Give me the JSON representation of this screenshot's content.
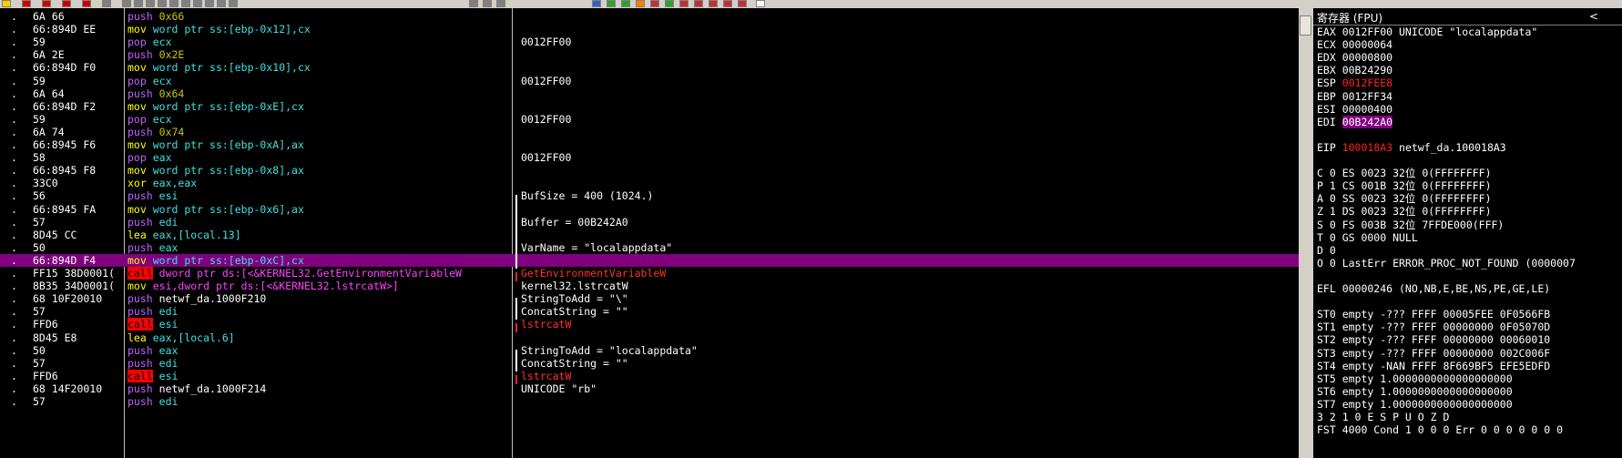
{
  "toolbar": {
    "buttons": 42
  },
  "cpu": {
    "rows": [
      {
        "dot": ".",
        "bytes": "6A 66",
        "mn": "push",
        "mcls": "kw-push",
        "ops": [
          {
            "t": "0x66",
            "c": "op-imm"
          }
        ],
        "comment": ""
      },
      {
        "dot": ".",
        "bytes": "66:894D EE",
        "mn": "mov",
        "mcls": "kw-mov",
        "ops": [
          {
            "t": "word ptr ss:[ebp-0x12],cx",
            "c": "op-mem"
          }
        ],
        "comment": ""
      },
      {
        "dot": ".",
        "bytes": "59",
        "mn": "pop",
        "mcls": "kw-pop",
        "ops": [
          {
            "t": "ecx",
            "c": "op-reg"
          }
        ],
        "comment": "0012FF00"
      },
      {
        "dot": ".",
        "bytes": "6A 2E",
        "mn": "push",
        "mcls": "kw-push",
        "ops": [
          {
            "t": "0x2E",
            "c": "op-imm"
          }
        ],
        "comment": ""
      },
      {
        "dot": ".",
        "bytes": "66:894D F0",
        "mn": "mov",
        "mcls": "kw-mov",
        "ops": [
          {
            "t": "word ptr ss:[ebp-0x10],cx",
            "c": "op-mem"
          }
        ],
        "comment": ""
      },
      {
        "dot": ".",
        "bytes": "59",
        "mn": "pop",
        "mcls": "kw-pop",
        "ops": [
          {
            "t": "ecx",
            "c": "op-reg"
          }
        ],
        "comment": "0012FF00"
      },
      {
        "dot": ".",
        "bytes": "6A 64",
        "mn": "push",
        "mcls": "kw-push",
        "ops": [
          {
            "t": "0x64",
            "c": "op-imm"
          }
        ],
        "comment": ""
      },
      {
        "dot": ".",
        "bytes": "66:894D F2",
        "mn": "mov",
        "mcls": "kw-mov",
        "ops": [
          {
            "t": "word ptr ss:[ebp-0xE],cx",
            "c": "op-mem"
          }
        ],
        "comment": ""
      },
      {
        "dot": ".",
        "bytes": "59",
        "mn": "pop",
        "mcls": "kw-pop",
        "ops": [
          {
            "t": "ecx",
            "c": "op-reg"
          }
        ],
        "comment": "0012FF00"
      },
      {
        "dot": ".",
        "bytes": "6A 74",
        "mn": "push",
        "mcls": "kw-push",
        "ops": [
          {
            "t": "0x74",
            "c": "op-imm"
          }
        ],
        "comment": ""
      },
      {
        "dot": ".",
        "bytes": "66:8945 F6",
        "mn": "mov",
        "mcls": "kw-mov",
        "ops": [
          {
            "t": "word ptr ss:[ebp-0xA],ax",
            "c": "op-mem"
          }
        ],
        "comment": ""
      },
      {
        "dot": ".",
        "bytes": "58",
        "mn": "pop",
        "mcls": "kw-pop",
        "ops": [
          {
            "t": "eax",
            "c": "op-reg"
          }
        ],
        "comment": "0012FF00"
      },
      {
        "dot": ".",
        "bytes": "66:8945 F8",
        "mn": "mov",
        "mcls": "kw-mov",
        "ops": [
          {
            "t": "word ptr ss:[ebp-0x8],ax",
            "c": "op-mem"
          }
        ],
        "comment": ""
      },
      {
        "dot": ".",
        "bytes": "33C0",
        "mn": "xor",
        "mcls": "kw-xor",
        "ops": [
          {
            "t": "eax,eax",
            "c": "op-reg"
          }
        ],
        "comment": ""
      },
      {
        "dot": ".",
        "bytes": "56",
        "mn": "push",
        "mcls": "kw-push",
        "ops": [
          {
            "t": "esi",
            "c": "op-reg"
          }
        ],
        "comment": "BufSize = 400 (1024.)"
      },
      {
        "dot": ".",
        "bytes": "66:8945 FA",
        "mn": "mov",
        "mcls": "kw-mov",
        "ops": [
          {
            "t": "word ptr ss:[ebp-0x6],ax",
            "c": "op-mem"
          }
        ],
        "comment": ""
      },
      {
        "dot": ".",
        "bytes": "57",
        "mn": "push",
        "mcls": "kw-push",
        "ops": [
          {
            "t": "edi",
            "c": "op-reg"
          }
        ],
        "comment": "Buffer = 00B242A0"
      },
      {
        "dot": ".",
        "bytes": "8D45 CC",
        "mn": "lea",
        "mcls": "kw-lea",
        "ops": [
          {
            "t": "eax,[local.13]",
            "c": "op-mem"
          }
        ],
        "comment": ""
      },
      {
        "dot": ".",
        "bytes": "50",
        "mn": "push",
        "mcls": "kw-push",
        "ops": [
          {
            "t": "eax",
            "c": "op-reg"
          }
        ],
        "comment": "VarName = \"localappdata\""
      },
      {
        "dot": ".",
        "bytes": "66:894D F4",
        "mn": "mov",
        "mcls": "kw-mov",
        "ops": [
          {
            "t": "word ptr ss:[ebp-0xC],cx",
            "c": "op-mem"
          }
        ],
        "comment": "",
        "hl": true
      },
      {
        "dot": ".",
        "bytes": "FF15 38D0001(",
        "mn": "call",
        "mcls": "kw-call",
        "ops": [
          {
            "t": "dword ptr ds:[<&KERNEL32.GetEnvironmentVariableW",
            "c": "op-sym"
          }
        ],
        "comment": "GetEnvironmentVariableW",
        "ccls": "cm-red"
      },
      {
        "dot": ".",
        "bytes": "8B35 34D0001(",
        "mn": "mov",
        "mcls": "kw-mov",
        "ops": [
          {
            "t": "esi,dword ptr ds:[<&KERNEL32.lstrcatW>]",
            "c": "op-sym"
          }
        ],
        "comment": "kernel32.lstrcatW"
      },
      {
        "dot": ".",
        "bytes": "68 10F20010",
        "mn": "push",
        "mcls": "kw-push",
        "ops": [
          {
            "t": "netwf_da.1000F210",
            "c": "op-plain"
          }
        ],
        "comment": "StringToAdd = \"\\\""
      },
      {
        "dot": ".",
        "bytes": "57",
        "mn": "push",
        "mcls": "kw-push",
        "ops": [
          {
            "t": "edi",
            "c": "op-reg"
          }
        ],
        "comment": "ConcatString = \"\""
      },
      {
        "dot": ".",
        "bytes": "FFD6",
        "mn": "call",
        "mcls": "kw-call",
        "ops": [
          {
            "t": "esi",
            "c": "op-reg"
          }
        ],
        "comment": "lstrcatW",
        "ccls": "cm-red"
      },
      {
        "dot": ".",
        "bytes": "8D45 E8",
        "mn": "lea",
        "mcls": "kw-lea",
        "ops": [
          {
            "t": "eax,[local.6]",
            "c": "op-mem"
          }
        ],
        "comment": ""
      },
      {
        "dot": ".",
        "bytes": "50",
        "mn": "push",
        "mcls": "kw-push",
        "ops": [
          {
            "t": "eax",
            "c": "op-reg"
          }
        ],
        "comment": "StringToAdd = \"localappdata\""
      },
      {
        "dot": ".",
        "bytes": "57",
        "mn": "push",
        "mcls": "kw-push",
        "ops": [
          {
            "t": "edi",
            "c": "op-reg"
          }
        ],
        "comment": "ConcatString = \"\""
      },
      {
        "dot": ".",
        "bytes": "FFD6",
        "mn": "call",
        "mcls": "kw-call",
        "ops": [
          {
            "t": "esi",
            "c": "op-reg"
          }
        ],
        "comment": "lstrcatW",
        "ccls": "cm-red"
      },
      {
        "dot": ".",
        "bytes": "68 14F20010",
        "mn": "push",
        "mcls": "kw-push",
        "ops": [
          {
            "t": "netwf_da.1000F214",
            "c": "op-plain"
          }
        ],
        "comment": "UNICODE \"rb\""
      },
      {
        "dot": ".",
        "bytes": "57",
        "mn": "push",
        "mcls": "kw-push",
        "ops": [
          {
            "t": "edi",
            "c": "op-reg"
          }
        ],
        "comment": ""
      }
    ]
  },
  "registers": {
    "title": "寄存器 (FPU)",
    "collapse_glyph": "<",
    "lines": [
      {
        "segs": [
          {
            "t": "EAX 0012FF00 UNICODE \"localappdata\""
          }
        ]
      },
      {
        "segs": [
          {
            "t": "ECX 00000064"
          }
        ]
      },
      {
        "segs": [
          {
            "t": "EDX 00000800"
          }
        ]
      },
      {
        "segs": [
          {
            "t": "EBX 00B24290"
          }
        ]
      },
      {
        "segs": [
          {
            "t": "ESP "
          },
          {
            "t": "0012FEE8",
            "c": "red-val"
          }
        ]
      },
      {
        "segs": [
          {
            "t": "EBP 0012FF34"
          }
        ]
      },
      {
        "segs": [
          {
            "t": "ESI 00000400"
          }
        ]
      },
      {
        "segs": [
          {
            "t": "EDI "
          },
          {
            "t": "00B242A0",
            "c": "purple-val"
          }
        ]
      },
      {
        "segs": [
          {
            "t": ""
          }
        ]
      },
      {
        "segs": [
          {
            "t": "EIP "
          },
          {
            "t": "100018A3",
            "c": "red-val"
          },
          {
            "t": " netwf_da.100018A3"
          }
        ]
      },
      {
        "segs": [
          {
            "t": ""
          }
        ]
      },
      {
        "segs": [
          {
            "t": "C 0  ES 0023 32位 0(FFFFFFFF)"
          }
        ]
      },
      {
        "segs": [
          {
            "t": "P 1  CS 001B 32位 0(FFFFFFFF)"
          }
        ]
      },
      {
        "segs": [
          {
            "t": "A 0  SS 0023 32位 0(FFFFFFFF)"
          }
        ]
      },
      {
        "segs": [
          {
            "t": "Z 1  DS 0023 32位 0(FFFFFFFF)"
          }
        ]
      },
      {
        "segs": [
          {
            "t": "S 0  FS 003B 32位 7FFDE000(FFF)"
          }
        ]
      },
      {
        "segs": [
          {
            "t": "T 0  GS 0000 NULL"
          }
        ]
      },
      {
        "segs": [
          {
            "t": "D 0"
          }
        ]
      },
      {
        "segs": [
          {
            "t": "O 0  LastErr ERROR_PROC_NOT_FOUND (0000007"
          }
        ]
      },
      {
        "segs": [
          {
            "t": ""
          }
        ]
      },
      {
        "segs": [
          {
            "t": "EFL 00000246 (NO,NB,E,BE,NS,PE,GE,LE)"
          }
        ]
      },
      {
        "segs": [
          {
            "t": ""
          }
        ]
      },
      {
        "segs": [
          {
            "t": "ST0 empty -??? FFFF 00005FEE 0F0566FB"
          }
        ]
      },
      {
        "segs": [
          {
            "t": "ST1 empty -??? FFFF 00000000 0F05070D"
          }
        ]
      },
      {
        "segs": [
          {
            "t": "ST2 empty -??? FFFF 00000000 00060010"
          }
        ]
      },
      {
        "segs": [
          {
            "t": "ST3 empty -??? FFFF 00000000 002C006F"
          }
        ]
      },
      {
        "segs": [
          {
            "t": "ST4 empty -NAN FFFF 8F669BF5 EFE5EDFD"
          }
        ]
      },
      {
        "segs": [
          {
            "t": "ST5 empty 1.0000000000000000000"
          }
        ]
      },
      {
        "segs": [
          {
            "t": "ST6 empty 1.0000000000000000000"
          }
        ]
      },
      {
        "segs": [
          {
            "t": "ST7 empty 1.0000000000000000000"
          }
        ]
      },
      {
        "segs": [
          {
            "t": "               3 2 1 0      E S P U O Z D"
          }
        ]
      },
      {
        "segs": [
          {
            "t": "FST 4000  Cond 1 0 0 0  Err 0 0 0 0 0 0 0"
          }
        ]
      }
    ]
  },
  "colors": {
    "highlight": "#800080",
    "call_bg": "#ff0000",
    "accent_red": "#ff2020"
  },
  "icons": [
    "toolbar-button-icon",
    "collapse-chevron-icon"
  ]
}
